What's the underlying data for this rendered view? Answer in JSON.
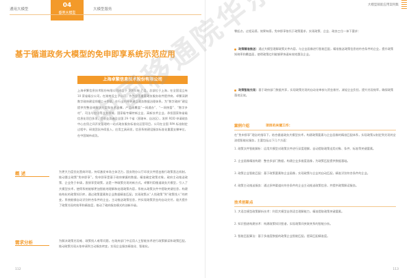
{
  "left_page": {
    "tabs": [
      {
        "label": "通用大模型"
      },
      {
        "num": "04",
        "label": "垂类大模型"
      },
      {
        "label": "大模型服务"
      }
    ],
    "title": "基于循道政务大模型的免申即享系统示范应用",
    "company": "上海卓繁信息技术股份有限公司",
    "intro": "上海卓繁信息技术股份有限公司成立于 2001 年 7 月，总部位于上海，在全国设立有 10 家省级分公司，在湖南设立子公司，作为全国重要政务服务软件提供商，卓繁深耕数字政府建设领域二十余载，在行业内率先建立政务数据治理体系，为“数字政府”建设提供完整咨询解决方案和技术支撑，产品线覆盖“一网通办”、“一网统管”、“数字乡村”、司法与应用等业务领域，国家级专精特新企业、高新技术企业，承担国家和省级信息化项目多项，目前业务遍及全国 29 个省（直辖市、自治区），发挥 RDD 申请政务中心应用之间开发管理的一站式政务服务标准化运营项目，公司在全国 RPA 标准制定过程中，研发团队持续投入，应用工具研发，信息系统建设服务标准化重要支撑单位，在中国城市成功。",
    "overview_label": "概 述",
    "overview": "为更大力度优化营商环境，持续激发市场主体活力，国务院办公厅印发文件提出推行政策直达机制，推动惠企政策“免申即享”。免申即享是基于政府掌握的数据，精准确定政策对象，政府主动推送政策、企业免于申请，直接享受政策，这是一种政策兑现的新方式。卓繁利用循道政务大模型，引入了大模型技术，使得系统能够更加智能地理解和处理政策内容，系统从政策文件中提取关键信息，构建结构化的政策知识库，通过政策要素和企业数据精准匹配，实现政策从“人找政策”到“政策找人”的转变，系统能够自动识别符合条件的企业，主动推送政策信息，并实现政策资金的自动兑付，极大提升了政策兑现的效率和精准度，推动了政府服务模式的创新升级。",
    "needs_label": "需求分析",
    "needs": "为解决政策兑现难、政策找人难等问题，在政府部门中运用人工智能技术进行政策解读和政策匹配，推动政策兑现从依申请到主动服务转变，实现企业服务精准化、智能化。",
    "page_number": "112"
  },
  "right_page": {
    "header": "大模型赋能应用案例集",
    "intro": "零起点，过程无感，效果有感，免申即享依托于政策要求，实现政策、企业、政务三位一体下要求：",
    "bullets": [
      {
        "bold": "政策精准推送：",
        "text": "通过大模型理解政策文件内容，与企业画像进行智能匹配，精准推送政策信息给符合条件的企业，提升政策知晓率和覆盖面，使得政策红利能够更快速有效地惠及企业。"
      },
      {
        "bold": "政策智能兑现：",
        "text": "基于政府部门数据共享，实现政策兑现的自动化审核与资金拨付，减轻企业负担，提升兑现效率，确保政策落地见效。"
      }
    ],
    "solution_label": "案例介绍",
    "solution_sub": "项目的关键工作：",
    "solution_intro": "在“免申即享”理念的指导下，结合循道政务大模型技术，构建政策要素与企业画像的精准匹配体系，实现政策从制定到兑现的全流程智能化服务，主要包括以下几个方面：",
    "solution_items": [
      "1. 政策文件智能解析：运用大模型对政策文件进行深度理解，自动提取政策适用对象、条件、标准等关键要素。",
      "2. 企业画像精准构建：整合多部门数据，构建企业多维度画像，为政策匹配提供数据基础。",
      "3. 政策企业智能匹配：基于政策要素和企业画像，实现政策与企业的自动匹配，精准识别符合条件的企业。",
      "4. 政策主动推送服务：通过多种渠道向符合条件的企业主动推送政策信息，并提供政策解读服务。"
    ],
    "tech_label": "技术创新点",
    "tech_items": [
      "1. 大语言模型政策解析技术：利用大模型自然语言理解能力，精准提取政策关键要素。",
      "2. 知识图谱构建技术：构建政策知识图谱，实现政策间关联关系的智能分析。",
      "3. 智能匹配算法：基于多维度数据的政策企业智能匹配，提高匹配精准度。"
    ],
    "page_number": "113"
  },
  "watermark": "中国移通院华东分院"
}
